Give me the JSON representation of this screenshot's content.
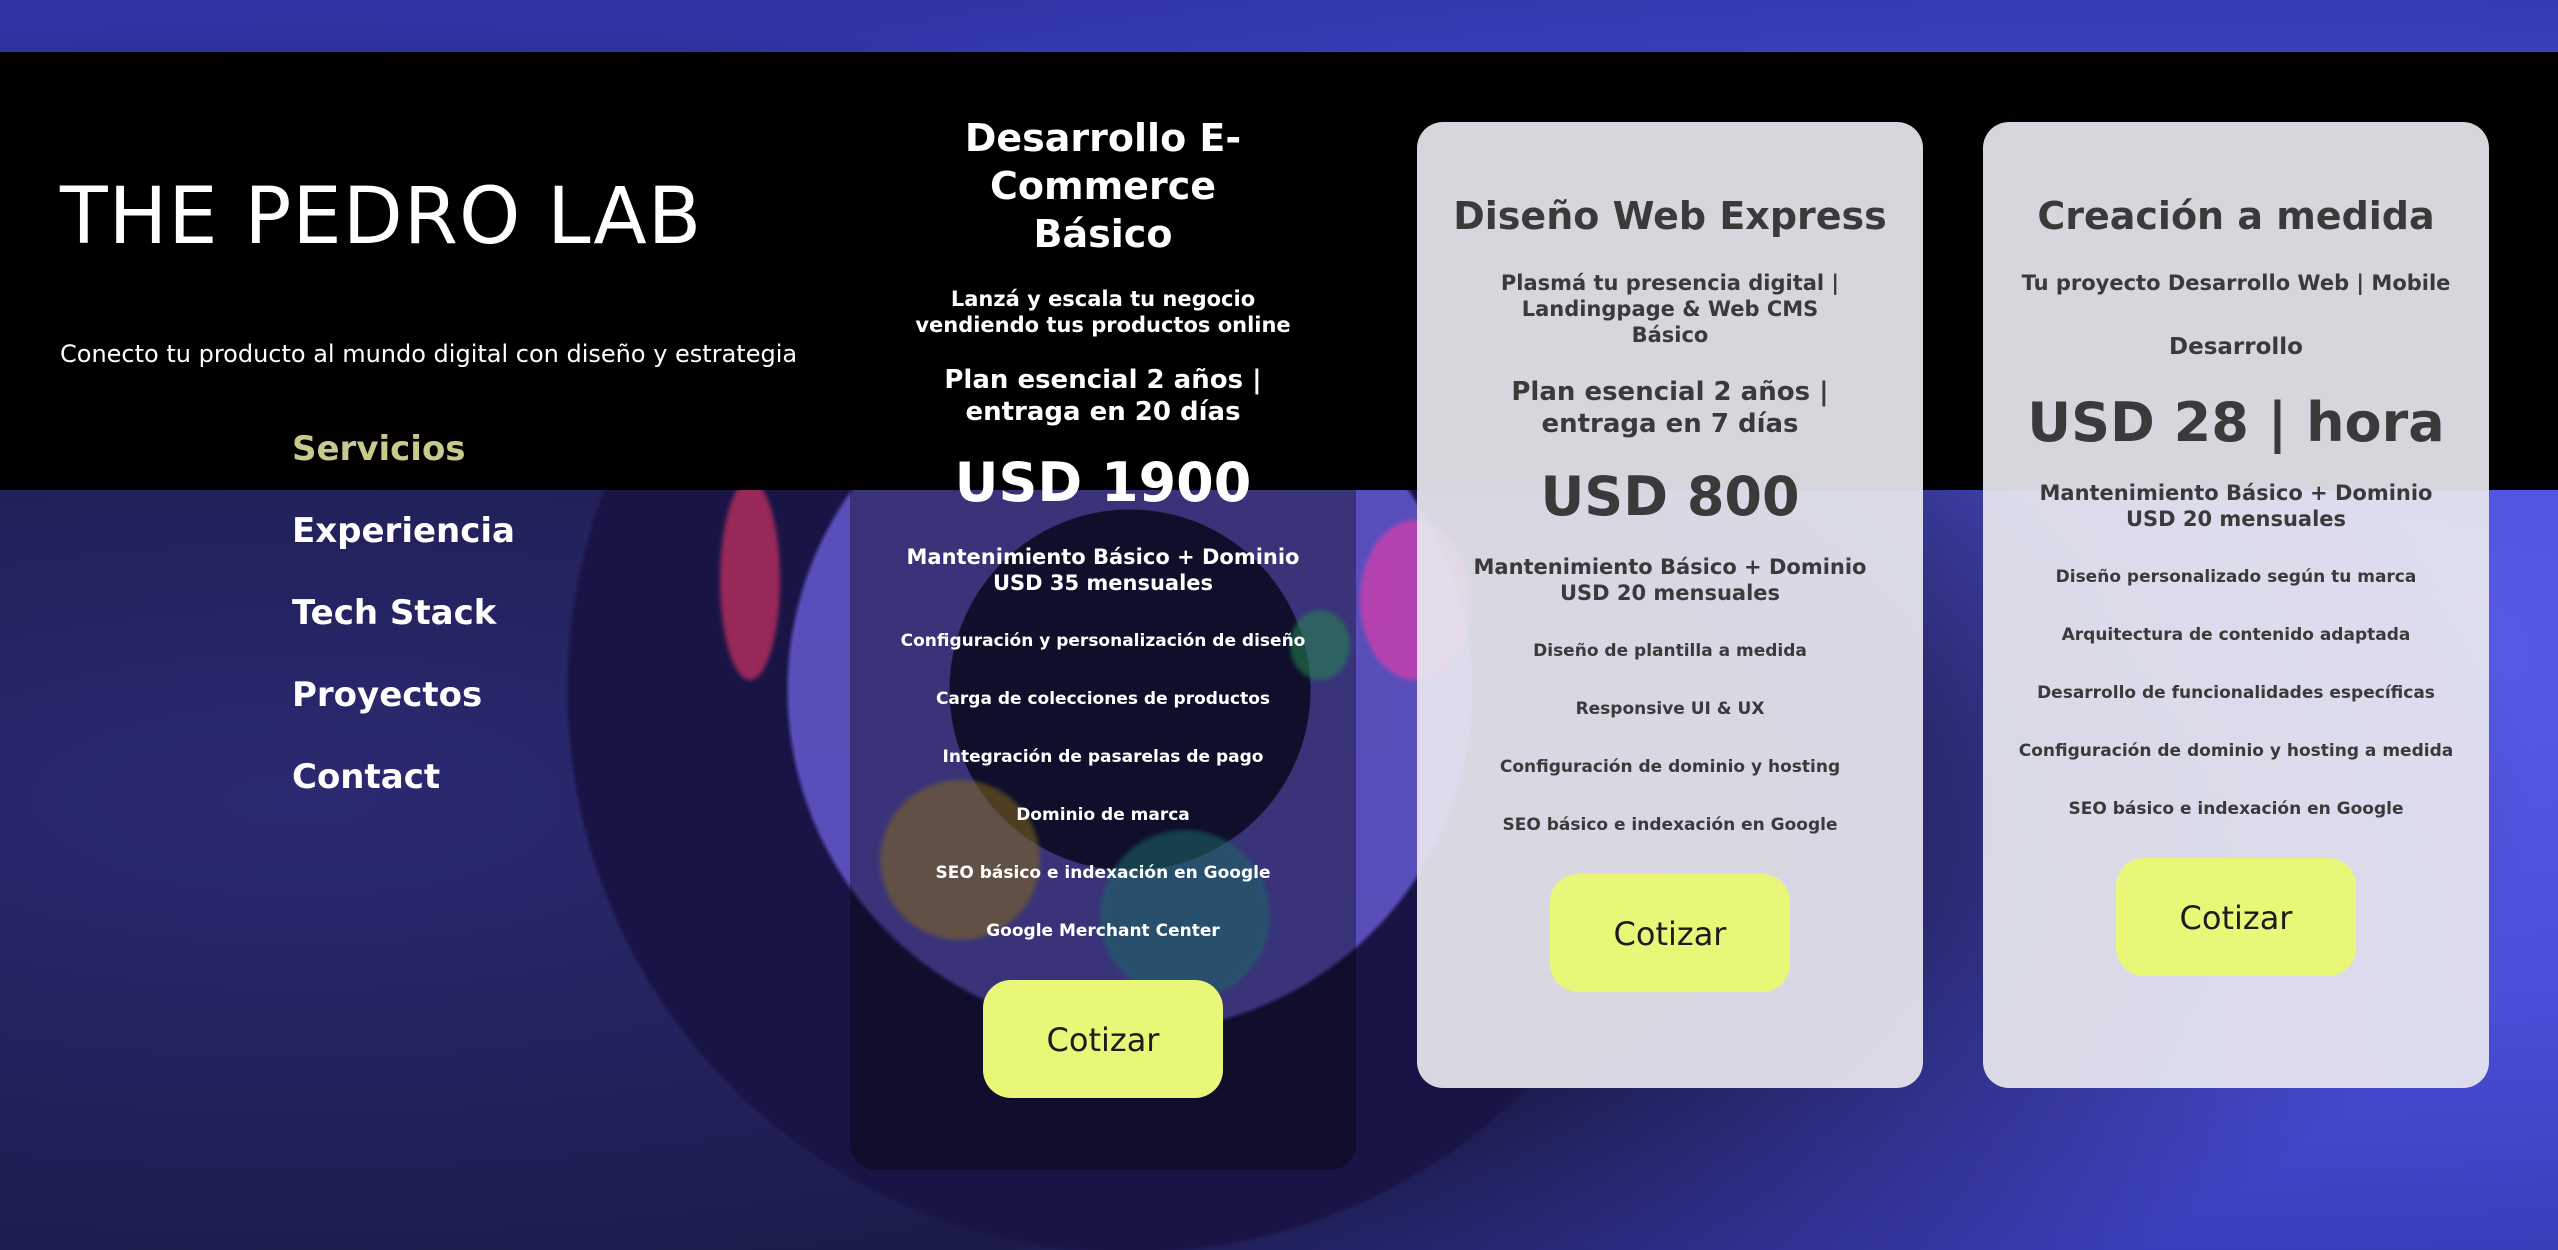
{
  "colors": {
    "accent": "#e9f778",
    "nav_active": "#c8c98a",
    "header_bg": "#000000"
  },
  "brand": {
    "title": "THE PEDRO LAB",
    "tagline": "Conecto tu producto al mundo digital con diseño y estrategia"
  },
  "nav": {
    "items": [
      {
        "label": "Servicios",
        "active": true
      },
      {
        "label": "Experiencia"
      },
      {
        "label": "Tech Stack"
      },
      {
        "label": "Proyectos"
      },
      {
        "label": "Contact"
      }
    ]
  },
  "plans": [
    {
      "title": "Desarrollo E-Commerce Básico",
      "subtitle": "Lanzá y escala tu negocio vendiendo tus productos online",
      "plan": "Plan esencial 2 años | entraga en 20 días",
      "price": "USD 1900",
      "maintenance": "Mantenimiento Básico + Dominio USD 35 mensuales",
      "features": [
        "Configuración y personalización de diseño",
        "Carga de colecciones de productos",
        "Integración de pasarelas de pago",
        "Dominio de marca",
        "SEO básico e indexación en Google",
        "Google Merchant Center"
      ],
      "cta": "Cotizar"
    },
    {
      "title": "Diseño Web Express",
      "subtitle": "Plasmá tu presencia digital | Landingpage & Web CMS Básico",
      "plan": "Plan esencial 2 años | entraga en 7 días",
      "price": "USD 800",
      "maintenance": "Mantenimiento Básico + Dominio USD 20 mensuales",
      "features": [
        "Diseño de plantilla a medida",
        "Responsive UI & UX",
        "Configuración de dominio y hosting",
        "SEO básico e indexación en Google"
      ],
      "cta": "Cotizar"
    },
    {
      "title": "Creación a medida",
      "subtitle": "Tu proyecto Desarrollo Web | Mobile",
      "plan": "Desarrollo",
      "price": "USD 28 | hora",
      "maintenance": "Mantenimiento Básico + Dominio USD 20 mensuales",
      "features": [
        "Diseño personalizado según tu marca",
        "Arquitectura de contenido adaptada",
        "Desarrollo de funcionalidades específicas",
        "Configuración de dominio y hosting a medida",
        "SEO básico e indexación en Google"
      ],
      "cta": "Cotizar"
    }
  ]
}
